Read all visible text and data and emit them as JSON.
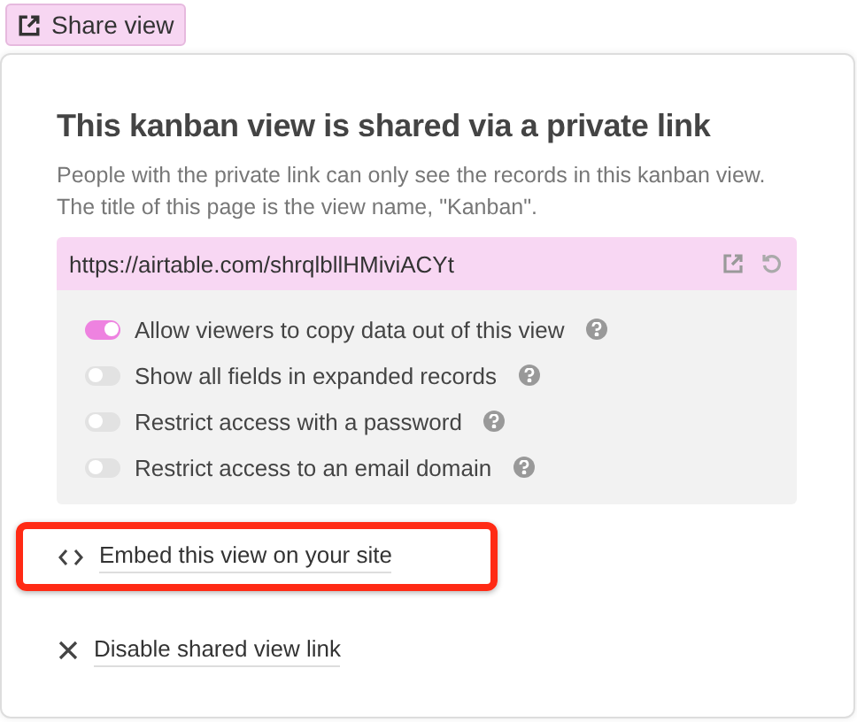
{
  "share_button": {
    "label": "Share view"
  },
  "popover": {
    "title": "This kanban view is shared via a private link",
    "description": "People with the private link can only see the records in this kanban view. The title of this page is the view name, \"Kanban\".",
    "link": {
      "url": "https://airtable.com/shrqlbllHMiviACYt"
    },
    "options": [
      {
        "label": "Allow viewers to copy data out of this view",
        "on": true
      },
      {
        "label": "Show all fields in expanded records",
        "on": false
      },
      {
        "label": "Restrict access with a password",
        "on": false
      },
      {
        "label": "Restrict access to an email domain",
        "on": false
      }
    ],
    "actions": [
      {
        "kind": "embed",
        "label": "Embed this view on your site",
        "highlighted": true
      },
      {
        "kind": "disable",
        "label": "Disable shared view link",
        "highlighted": false
      }
    ]
  }
}
